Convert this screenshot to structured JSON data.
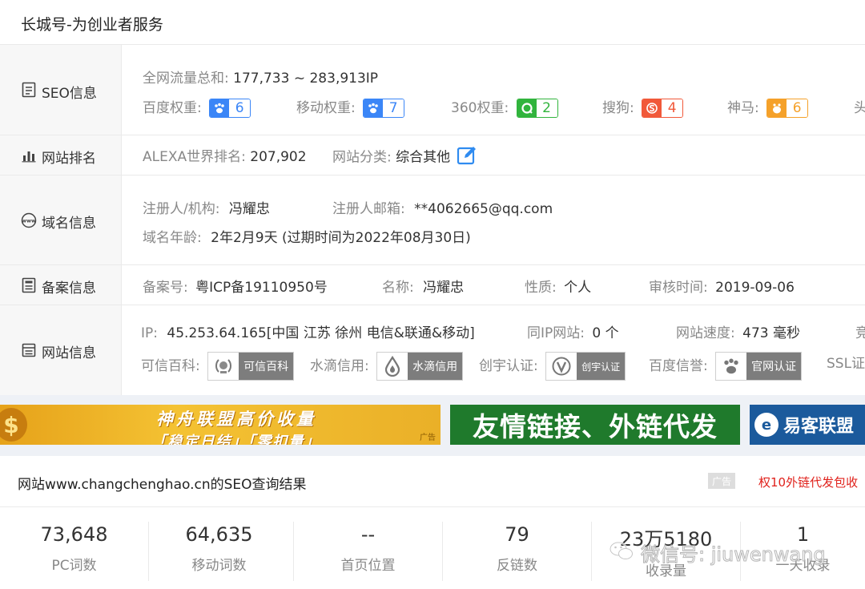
{
  "page_title": "长城号-为创业者服务",
  "seo": {
    "label": "SEO信息",
    "traffic_key": "全网流量总和:",
    "traffic_value": "177,733 ~ 283,913IP",
    "weights": [
      {
        "key": "百度权重:",
        "value": "6",
        "icon": "paw-icon",
        "color": "#3b86f7"
      },
      {
        "key": "移动权重:",
        "value": "7",
        "icon": "paw-icon",
        "color": "#3b86f7"
      },
      {
        "key": "360权重:",
        "value": "2",
        "icon": "360-icon",
        "color": "#31b43d"
      },
      {
        "key": "搜狗:",
        "value": "4",
        "icon": "sogou-icon",
        "color": "#f1593a"
      },
      {
        "key": "神马:",
        "value": "6",
        "icon": "shenma-icon",
        "color": "#f5a12a"
      }
    ],
    "cut_text": "头"
  },
  "rank": {
    "label": "网站排名",
    "alexa_key": "ALEXA世界排名:",
    "alexa_value": "207,902",
    "category_key": "网站分类:",
    "category_value": "综合其他"
  },
  "domain": {
    "label": "域名信息",
    "registrant_key": "注册人/机构:",
    "registrant_value": "冯耀忠",
    "email_key": "注册人邮箱:",
    "email_value": "**4062665@qq.com",
    "age_key": "域名年龄:",
    "age_value": "2年2月9天 (过期时间为2022年08月30日)"
  },
  "icp": {
    "label": "备案信息",
    "no_key": "备案号:",
    "no_value": "粤ICP备19110950号",
    "name_key": "名称:",
    "name_value": "冯耀忠",
    "nature_key": "性质:",
    "nature_value": "个人",
    "review_key": "审核时间:",
    "review_value": "2019-09-06"
  },
  "site": {
    "label": "网站信息",
    "ip_key": "IP:",
    "ip_value": "45.253.64.165[中国 江苏 徐州 电信&联通&移动]",
    "sameip_key": "同IP网站:",
    "sameip_value": "0 个",
    "speed_key": "网站速度:",
    "speed_value": "473 毫秒",
    "cut_text": "竞",
    "certs": [
      {
        "key": "可信百科:",
        "label": "可信百科",
        "icon": "laurel-icon"
      },
      {
        "key": "水滴信用:",
        "label": "水滴信用",
        "icon": "water-drop-icon"
      },
      {
        "key": "创宇认证:",
        "label": "创宇认证",
        "icon": "v-shield-icon"
      },
      {
        "key": "百度信誉:",
        "label": "官网认证",
        "icon": "baidu-paw-icon"
      }
    ],
    "ssl_cut": "SSL证"
  },
  "banners": {
    "b1_line1": "神舟联盟高价收量",
    "b1_line2": "「稳定日结」「零扣量」",
    "b1_tag": "广告",
    "b2_text": "友情链接、外链代发",
    "b3_text": "易客联盟"
  },
  "result": {
    "title": "网站www.changchenghao.cn的SEO查询结果",
    "ad_tag": "广告",
    "ad_link": "权10外链代发包收"
  },
  "stats": [
    {
      "value": "73,648",
      "label": "PC词数"
    },
    {
      "value": "64,635",
      "label": "移动词数"
    },
    {
      "value": "--",
      "label": "首页位置"
    },
    {
      "value": "79",
      "label": "反链数"
    },
    {
      "value": "23万5180",
      "label": "收录量"
    },
    {
      "value": "1",
      "label": "一天收录"
    }
  ],
  "watermark": "微信号: jiuwenwang"
}
